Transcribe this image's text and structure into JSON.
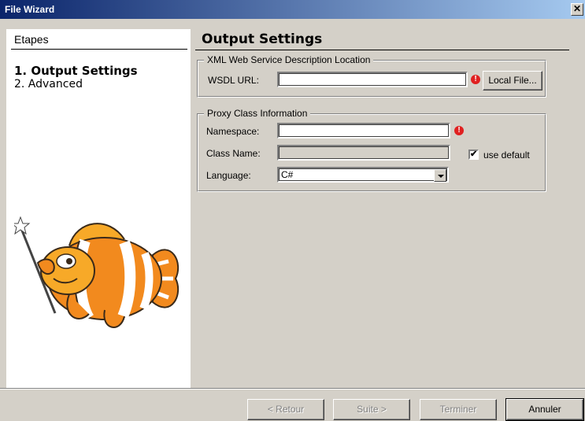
{
  "window": {
    "title": "File Wizard",
    "close_glyph": "✕"
  },
  "sidebar": {
    "header": "Etapes",
    "steps": [
      {
        "label": "1. Output Settings",
        "active": true
      },
      {
        "label": "2. Advanced",
        "active": false
      }
    ]
  },
  "main": {
    "title": "Output Settings",
    "wsdl_group": {
      "legend": "XML Web Service Description Location",
      "url_label": "WSDL URL:",
      "url_value": "",
      "error_glyph": "!",
      "local_file_button": "Local File..."
    },
    "proxy_group": {
      "legend": "Proxy Class Information",
      "namespace_label": "Namespace:",
      "namespace_value": "",
      "error_glyph": "!",
      "classname_label": "Class Name:",
      "classname_value": "",
      "use_default_label": "use default",
      "use_default_checked": "✔",
      "language_label": "Language:",
      "language_value": "C#"
    }
  },
  "footer": {
    "back_button": "< Retour",
    "next_button": "Suite >",
    "finish_button": "Terminer",
    "cancel_button": "Annuler"
  },
  "colors": {
    "error": "#e02020",
    "titlebar_start": "#0a246a",
    "titlebar_end": "#a6caf0"
  }
}
